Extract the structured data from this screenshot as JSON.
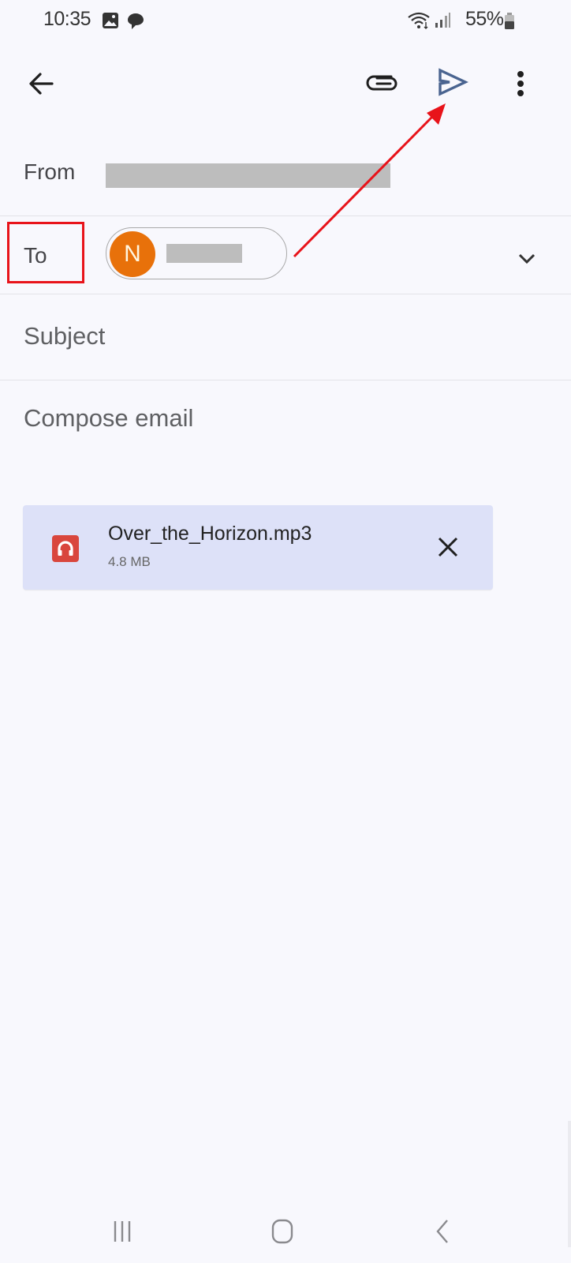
{
  "status_bar": {
    "time": "10:35",
    "notification_icons": [
      "gallery-icon",
      "chat-bubble-icon"
    ],
    "system_icons": [
      "wifi-icon",
      "signal-icon"
    ],
    "battery_percent": "55%"
  },
  "toolbar": {
    "back_icon": "arrow-left-icon",
    "attach_icon": "paperclip-icon",
    "send_icon": "send-icon",
    "more_icon": "more-vert-icon"
  },
  "compose": {
    "from_label": "From",
    "from_value": "[redacted]",
    "to_label": "To",
    "recipient_chip": {
      "avatar_initial": "N",
      "avatar_color": "#e8710a",
      "name": "[redacted]"
    },
    "subject_placeholder": "Subject",
    "body_placeholder": "Compose email"
  },
  "attachment": {
    "file_name": "Over_the_Horizon.mp3",
    "file_size": "4.8 MB",
    "type_icon": "headphones-icon",
    "icon_color": "#d9463d",
    "remove_icon": "close-icon"
  },
  "annotations": {
    "highlight_box_color": "#e8131a",
    "arrow_color": "#e8131a",
    "arrow_target": "send-button"
  },
  "nav_bar": {
    "recent_apps": "recent-apps-icon",
    "home": "home-icon",
    "back": "nav-back-icon"
  },
  "colors": {
    "background": "#f8f8fd",
    "send_icon": "#4a6490",
    "attachment_bg": "#dde1f8"
  }
}
